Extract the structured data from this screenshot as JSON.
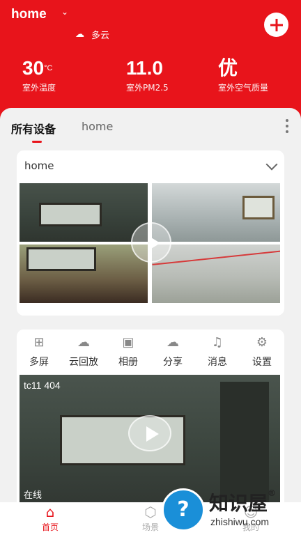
{
  "header": {
    "home_name": "home",
    "chevron": "chevron-down-icon",
    "weather_icon": "cloud-icon",
    "weather_text": "多云",
    "add_icon": "plus-icon",
    "accent_color": "#e8141b"
  },
  "stats": [
    {
      "value": "30",
      "unit": "°C",
      "label": "室外温度"
    },
    {
      "value": "11.0",
      "unit": "",
      "label": "室外PM2.5"
    },
    {
      "value": "优",
      "unit": "",
      "label": "室外空气质量"
    }
  ],
  "tabs": [
    {
      "label": "所有设备",
      "active": true
    },
    {
      "label": "home",
      "active": false
    }
  ],
  "group_card": {
    "title": "home",
    "thumbs_count": 4
  },
  "actions": [
    {
      "label": "多屏",
      "icon": "grid-icon"
    },
    {
      "label": "云回放",
      "icon": "cloud-play-icon"
    },
    {
      "label": "相册",
      "icon": "image-icon"
    },
    {
      "label": "分享",
      "icon": "share-cloud-icon"
    },
    {
      "label": "消息",
      "icon": "bell-icon"
    },
    {
      "label": "设置",
      "icon": "gear-icon"
    }
  ],
  "camera": {
    "name": "tc11 404",
    "status": "在线"
  },
  "bottom_nav": [
    {
      "label": "首页",
      "icon": "home-icon",
      "active": true
    },
    {
      "label": "场景",
      "icon": "hexagons-icon",
      "active": false
    },
    {
      "label": "我的",
      "icon": "user-icon",
      "active": false
    }
  ],
  "watermark": {
    "title": "知识屋",
    "reg": "®",
    "url": "zhishiwu.com",
    "badge_glyph": "?"
  }
}
